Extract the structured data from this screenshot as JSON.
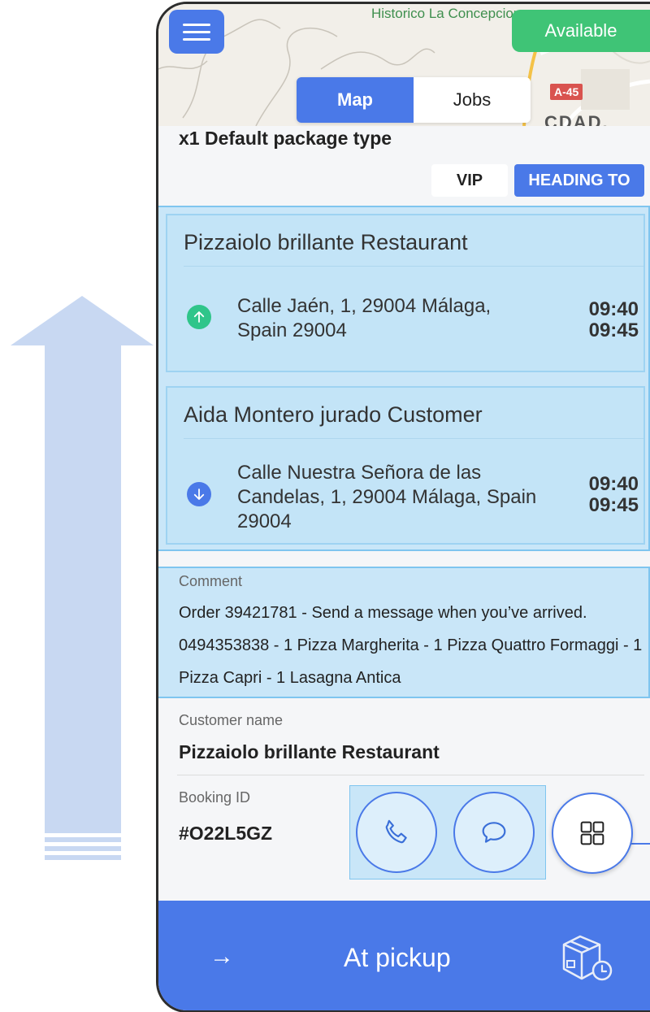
{
  "map": {
    "top_label": "Historico La Concepcion",
    "road_badge": "A-45",
    "area_label": "CDAD. JARD"
  },
  "header": {
    "status_button": "Available",
    "tabs": [
      {
        "label": "Map",
        "active": true
      },
      {
        "label": "Jobs",
        "active": false
      }
    ]
  },
  "job": {
    "package": "x1 Default package type",
    "badges": {
      "vip": "VIP",
      "status": "HEADING TO"
    },
    "stops": [
      {
        "type": "pickup",
        "icon": "arrow-up-icon",
        "name": "Pizzaiolo brillante Restaurant",
        "address": "Calle Jaén, 1, 29004 Málaga, Spain 29004",
        "time_start": "09:40",
        "time_end": "09:45"
      },
      {
        "type": "dropoff",
        "icon": "arrow-down-icon",
        "name": "Aida Montero jurado Customer",
        "address": "Calle Nuestra Señora de las Candelas, 1, 29004 Málaga, Spain 29004",
        "time_start": "09:40",
        "time_end": "09:45"
      }
    ],
    "comment_label": "Comment",
    "comment": "Order 39421781 - Send a message when you’ve arrived. 0494353838 - 1 Pizza Margherita - 1 Pizza Quattro Formaggi - 1 Pizza Capri - 1 Lasagna Antica",
    "customer_label": "Customer name",
    "customer_name": "Pizzaiolo brillante Restaurant",
    "booking_label": "Booking ID",
    "booking_id": "#O22L5GZ"
  },
  "footer": {
    "action_label": "At pickup",
    "arrow_icon": "arrow-right-icon",
    "right_icon": "package-clock-icon"
  },
  "colors": {
    "primary": "#4a79e8",
    "available": "#3fc476",
    "pickup": "#2fc58a",
    "highlight": "#c9e6f8"
  }
}
